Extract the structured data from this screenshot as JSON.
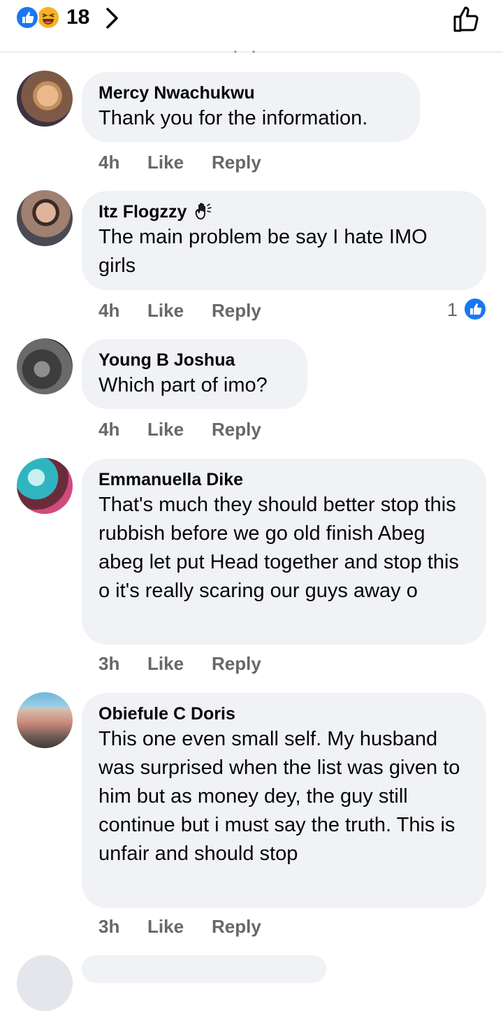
{
  "reactions": {
    "count": "18"
  },
  "comments": [
    {
      "name": "Mercy Nwachukwu",
      "text": "Thank you for the information.",
      "time": "4h",
      "like": "Like",
      "reply": "Reply"
    },
    {
      "name": "Itz Flogzzy",
      "text": "The main problem be say I hate IMO girls",
      "time": "4h",
      "like": "Like",
      "reply": "Reply",
      "likes": "1"
    },
    {
      "name": "Young B Joshua",
      "text": "Which part of imo?",
      "time": "4h",
      "like": "Like",
      "reply": "Reply"
    },
    {
      "name": "Emmanuella Dike",
      "text": "That's much they should better  stop this rubbish before we go old finish Abeg abeg let put Head together and stop this o it's really scaring our guys away o",
      "time": "3h",
      "like": "Like",
      "reply": "Reply"
    },
    {
      "name": "Obiefule C Doris",
      "text": "This one even small self. My husband was surprised when the list was given to him but as money dey, the guy still continue but i must say the truth.  This is unfair and should stop",
      "time": "3h",
      "like": "Like",
      "reply": "Reply"
    }
  ],
  "colors": {
    "accent": "#1877f2",
    "bubble": "#f0f2f5",
    "muted": "#65676b"
  }
}
